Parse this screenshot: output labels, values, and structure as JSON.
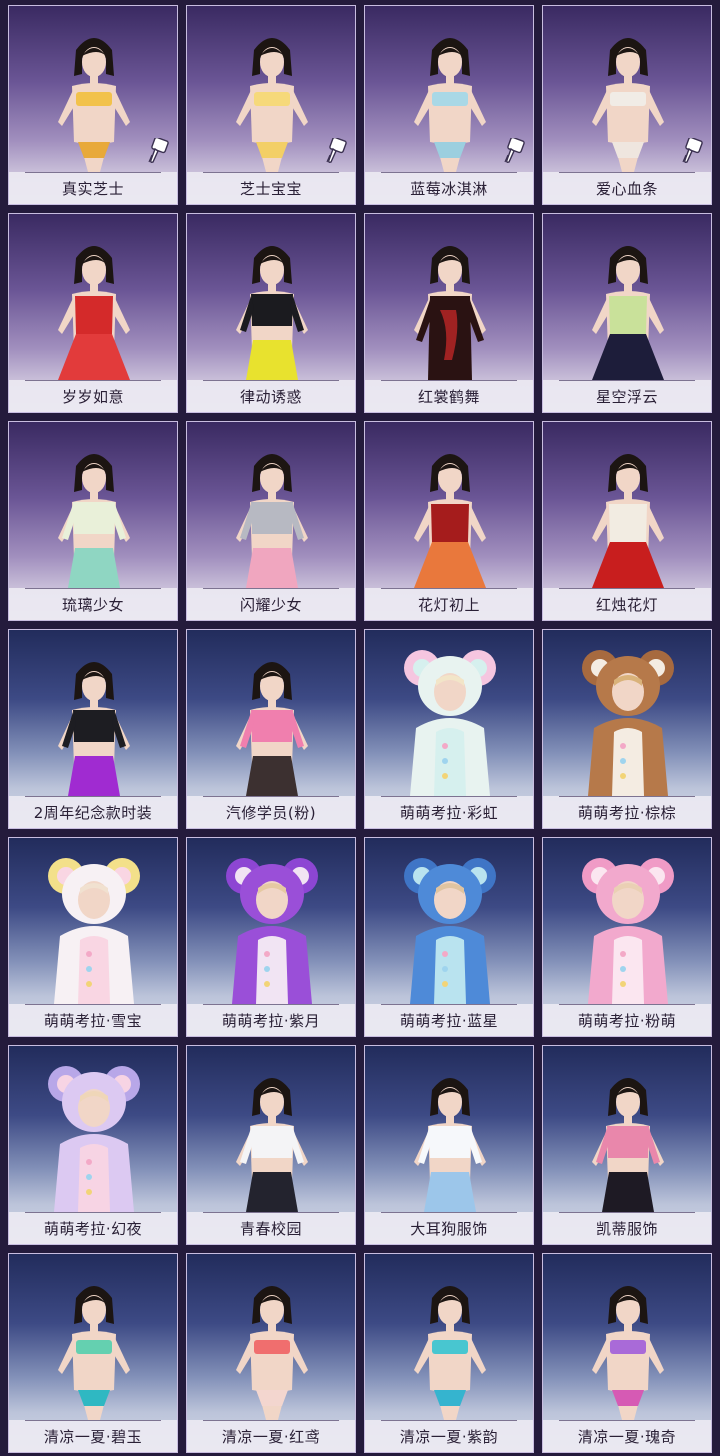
{
  "items": [
    {
      "name": "真实芝士",
      "bg": "purple",
      "style": "bikini",
      "top": "#f2c24b",
      "bottom": "#e8a93a",
      "hair": "#1c1512",
      "has_dye_icon": true
    },
    {
      "name": "芝士宝宝",
      "bg": "purple",
      "style": "bikini",
      "top": "#f6d97a",
      "bottom": "#f3cf66",
      "hair": "#1c1512",
      "has_dye_icon": true
    },
    {
      "name": "蓝莓冰淇淋",
      "bg": "purple",
      "style": "bikini",
      "top": "#a9d8e6",
      "bottom": "#9ccfdf",
      "hair": "#1c1512",
      "has_dye_icon": true
    },
    {
      "name": "爱心血条",
      "bg": "purple",
      "style": "bikini",
      "top": "#f1ece6",
      "bottom": "#efe6df",
      "hair": "#1c1512",
      "has_dye_icon": true
    },
    {
      "name": "岁岁如意",
      "bg": "purple",
      "style": "dress",
      "top": "#d42a2a",
      "bottom": "#e23b3b",
      "hair": "#1c1512",
      "has_dye_icon": false
    },
    {
      "name": "律动诱惑",
      "bg": "purple",
      "style": "outfit",
      "top": "#1b1b1f",
      "bottom": "#e8e22e",
      "hair": "#1c1512",
      "has_dye_icon": false
    },
    {
      "name": "红裳鹤舞",
      "bg": "purple",
      "style": "longdress",
      "top": "#2a1212",
      "bottom": "#a02222",
      "hair": "#1c1512",
      "has_dye_icon": false
    },
    {
      "name": "星空浮云",
      "bg": "purple",
      "style": "dress",
      "top": "#c9e19a",
      "bottom": "#1d1d3a",
      "hair": "#1c1512",
      "has_dye_icon": false
    },
    {
      "name": "琉璃少女",
      "bg": "purple",
      "style": "outfit",
      "top": "#e9f0d9",
      "bottom": "#8fd6c2",
      "hair": "#1c1512",
      "has_dye_icon": false
    },
    {
      "name": "闪耀少女",
      "bg": "purple",
      "style": "outfit",
      "top": "#b7b9c2",
      "bottom": "#f0a6bf",
      "hair": "#1c1512",
      "has_dye_icon": false
    },
    {
      "name": "花灯初上",
      "bg": "purple",
      "style": "dress",
      "top": "#a51c1c",
      "bottom": "#e9783c",
      "hair": "#1c1512",
      "has_dye_icon": false
    },
    {
      "name": "红烛花灯",
      "bg": "purple",
      "style": "dress",
      "top": "#f2ece2",
      "bottom": "#c81e1e",
      "hair": "#1c1512",
      "has_dye_icon": false
    },
    {
      "name": "2周年纪念款时装",
      "bg": "night",
      "style": "outfit",
      "top": "#1d1d22",
      "bottom": "#a02bd1",
      "hair": "#1c1512",
      "has_dye_icon": false
    },
    {
      "name": "汽修学员(粉)",
      "bg": "night",
      "style": "outfit",
      "top": "#f07fae",
      "bottom": "#3c3030",
      "hair": "#1c1512",
      "has_dye_icon": false
    },
    {
      "name": "萌萌考拉·彩虹",
      "bg": "night",
      "style": "koala",
      "top": "#e8f3f0",
      "bottom": "#d6f0ee",
      "hair": "#f2e5c8",
      "ears": "#f5c6e0",
      "has_dye_icon": false
    },
    {
      "name": "萌萌考拉·棕棕",
      "bg": "night",
      "style": "koala",
      "top": "#b6794a",
      "bottom": "#f4ece2",
      "hair": "#d9b27a",
      "ears": "#a76a3f",
      "has_dye_icon": false
    },
    {
      "name": "萌萌考拉·雪宝",
      "bg": "night",
      "style": "koala",
      "top": "#f7f1f4",
      "bottom": "#f9d6e3",
      "hair": "#f1e1d0",
      "ears": "#f3e08a",
      "has_dye_icon": false
    },
    {
      "name": "萌萌考拉·紫月",
      "bg": "night",
      "style": "koala",
      "top": "#9a4fd8",
      "bottom": "#f1e4f3",
      "hair": "#e5c9a2",
      "ears": "#8d46d3",
      "has_dye_icon": false
    },
    {
      "name": "萌萌考拉·蓝星",
      "bg": "night",
      "style": "koala",
      "top": "#4e8ad8",
      "bottom": "#b9e3ef",
      "hair": "#e0c4a0",
      "ears": "#3f75c6",
      "has_dye_icon": false
    },
    {
      "name": "萌萌考拉·粉萌",
      "bg": "night",
      "style": "koala",
      "top": "#f2a9cd",
      "bottom": "#fbe6f0",
      "hair": "#ead0b4",
      "ears": "#f09bc6",
      "has_dye_icon": false
    },
    {
      "name": "萌萌考拉·幻夜",
      "bg": "night",
      "style": "koala",
      "top": "#dcc9f2",
      "bottom": "#f7d4e4",
      "hair": "#efd6b8",
      "ears": "#b8a7e8",
      "has_dye_icon": false
    },
    {
      "name": "青春校园",
      "bg": "night",
      "style": "outfit",
      "top": "#f4f4f6",
      "bottom": "#23232e",
      "hair": "#1c1512",
      "has_dye_icon": false
    },
    {
      "name": "大耳狗服饰",
      "bg": "night",
      "style": "outfit",
      "top": "#f6f8fb",
      "bottom": "#9cc6ea",
      "hair": "#1c1512",
      "has_dye_icon": false
    },
    {
      "name": "凯蒂服饰",
      "bg": "night",
      "style": "outfit",
      "top": "#e987ab",
      "bottom": "#1e1a24",
      "hair": "#1c1512",
      "has_dye_icon": false
    },
    {
      "name": "清凉一夏·碧玉",
      "bg": "night",
      "style": "bikini",
      "top": "#64d0b0",
      "bottom": "#2fb8c2",
      "hair": "#1c1512",
      "has_dye_icon": false
    },
    {
      "name": "清凉一夏·红鸢",
      "bg": "night",
      "style": "bikini",
      "top": "#f06e6e",
      "bottom": "#f3d6cf",
      "hair": "#1c1512",
      "has_dye_icon": false
    },
    {
      "name": "清凉一夏·紫韵",
      "bg": "night",
      "style": "bikini",
      "top": "#48c6d0",
      "bottom": "#35b4cf",
      "hair": "#1c1512",
      "has_dye_icon": false
    },
    {
      "name": "清凉一夏·瑰奇",
      "bg": "night",
      "style": "bikini",
      "top": "#a96ad8",
      "bottom": "#d65ab4",
      "hair": "#1c1512",
      "has_dye_icon": false
    }
  ],
  "colors": {
    "skin": "#f1d6c7",
    "card_border": "#c8bde0",
    "caption_bg": "#ece9f2",
    "caption_text": "#2a2036"
  }
}
